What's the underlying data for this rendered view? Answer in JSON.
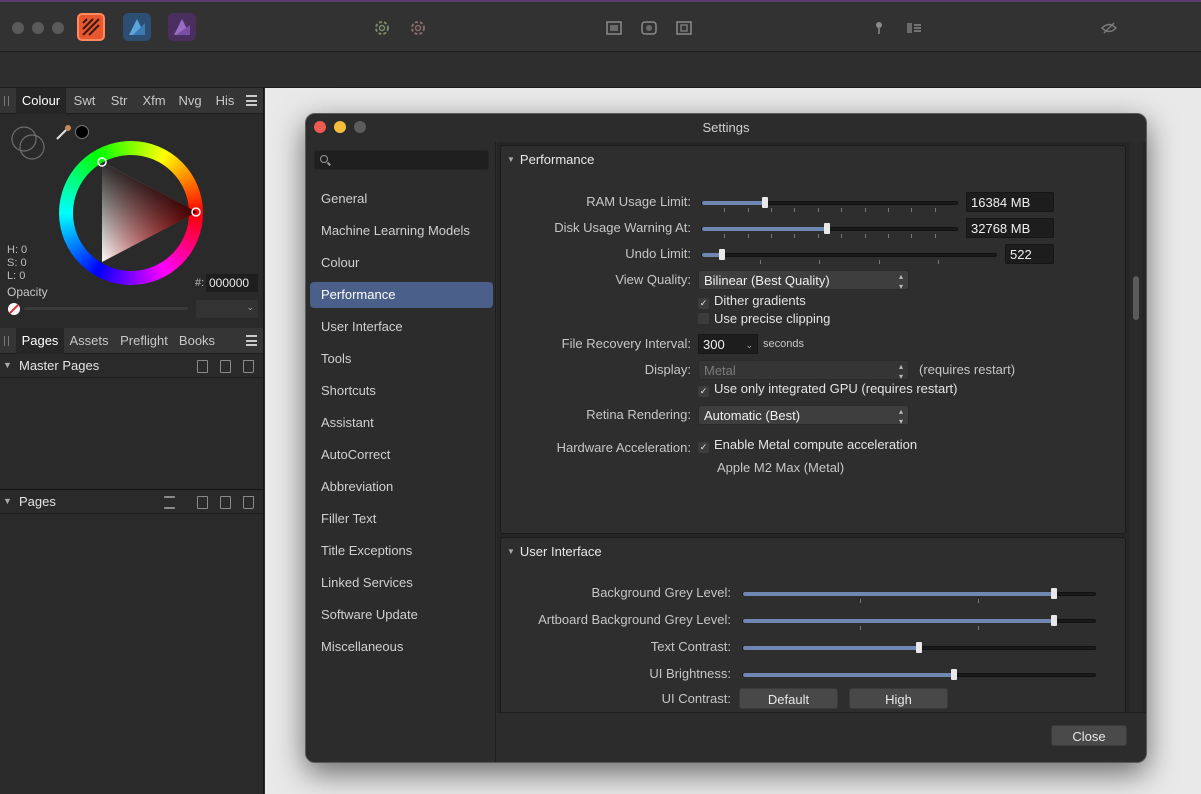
{
  "left_panel": {
    "tabs": [
      "Colour",
      "Swt",
      "Str",
      "Xfm",
      "Nvg",
      "His"
    ],
    "hsl": {
      "h": "H: 0",
      "s": "S: 0",
      "l": "L: 0"
    },
    "hex_prefix": "#:",
    "hex_value": "000000",
    "opacity_label": "Opacity",
    "pages_tabs": [
      "Pages",
      "Assets",
      "Preflight",
      "Books"
    ],
    "master_pages_label": "Master Pages",
    "pages_label": "Pages"
  },
  "dialog": {
    "title": "Settings",
    "nav": [
      "General",
      "Machine Learning Models",
      "Colour",
      "Performance",
      "User Interface",
      "Tools",
      "Shortcuts",
      "Assistant",
      "AutoCorrect",
      "Abbreviation",
      "Filler Text",
      "Title Exceptions",
      "Linked Services",
      "Software Update",
      "Miscellaneous"
    ],
    "selected_nav": "Performance",
    "performance": {
      "title": "Performance",
      "ram_label": "RAM Usage Limit:",
      "ram_value": "16384 MB",
      "ram_level": 0.24,
      "disk_label": "Disk Usage Warning At:",
      "disk_value": "32768 MB",
      "disk_level": 0.49,
      "undo_label": "Undo Limit:",
      "undo_value": "522",
      "undo_level": 0.06,
      "view_quality_label": "View Quality:",
      "view_quality_value": "Bilinear (Best Quality)",
      "dither_label": "Dither gradients",
      "dither_checked": true,
      "precise_label": "Use precise clipping",
      "precise_checked": false,
      "recovery_label": "File Recovery Interval:",
      "recovery_value": "300",
      "recovery_unit": "seconds",
      "display_label": "Display:",
      "display_value": "Metal",
      "display_note": "(requires restart)",
      "integrated_gpu_label": "Use only integrated GPU (requires restart)",
      "integrated_gpu_checked": true,
      "retina_label": "Retina Rendering:",
      "retina_value": "Automatic (Best)",
      "hw_label": "Hardware Acceleration:",
      "hw_check_label": "Enable Metal compute acceleration",
      "hw_checked": true,
      "gpu_name": "Apple M2 Max (Metal)"
    },
    "user_interface": {
      "title": "User Interface",
      "bg_grey_label": "Background Grey Level:",
      "bg_grey_level": 0.89,
      "artboard_grey_label": "Artboard Background Grey Level:",
      "artboard_grey_level": 0.89,
      "text_contrast_label": "Text Contrast:",
      "text_contrast_level": 0.5,
      "ui_brightness_label": "UI Brightness:",
      "ui_brightness_level": 0.6,
      "ui_contrast_label": "UI Contrast:",
      "contrast_default": "Default",
      "contrast_high": "High"
    },
    "close_label": "Close"
  }
}
